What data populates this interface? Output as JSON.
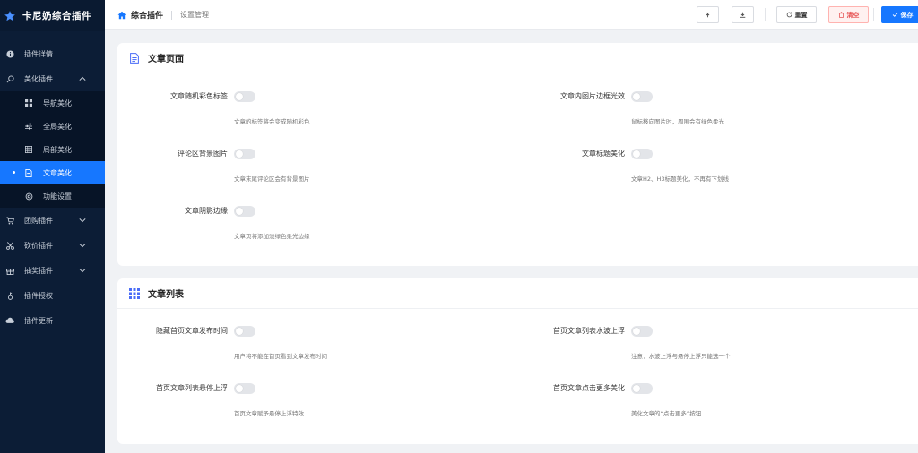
{
  "app": {
    "title": "卡尼奶综合插件"
  },
  "sidebar": {
    "items": [
      {
        "label": "插件详情",
        "icon": "info-icon"
      },
      {
        "label": "美化插件",
        "icon": "search-icon",
        "expanded": true
      },
      {
        "label": "导航美化",
        "icon": "grid-icon"
      },
      {
        "label": "全局美化",
        "icon": "sliders-icon"
      },
      {
        "label": "局部美化",
        "icon": "table-icon"
      },
      {
        "label": "文章美化",
        "icon": "document-icon",
        "active": true
      },
      {
        "label": "功能设置",
        "icon": "settings-icon"
      },
      {
        "label": "团购插件",
        "icon": "cart-icon"
      },
      {
        "label": "砍价插件",
        "icon": "scissors-icon"
      },
      {
        "label": "抽奖插件",
        "icon": "gift-icon"
      },
      {
        "label": "插件授权",
        "icon": "key-icon"
      },
      {
        "label": "插件更新",
        "icon": "cloud-icon"
      }
    ]
  },
  "header": {
    "breadcrumb_home": "综合插件",
    "breadcrumb_current": "设置管理",
    "reset_label": "重置",
    "clear_label": "清空",
    "save_label": "保存"
  },
  "sections": [
    {
      "title": "文章页面",
      "settings": [
        {
          "label": "文章随机彩色标签",
          "hint": "文章的标签将会变成随机彩色",
          "enabled": false
        },
        {
          "label": "文章内图片边框光效",
          "hint": "鼠标移向图片时，周围会有绿色柔光",
          "enabled": false
        },
        {
          "label": "评论区背景图片",
          "hint": "文章末尾评论区会有背景图片",
          "enabled": false
        },
        {
          "label": "文章标题美化",
          "hint": "文章H2、H3标题美化，不再有下划线",
          "enabled": false
        },
        {
          "label": "文章阴影边缘",
          "hint": "文章页将添加淡绿色柔光边缘",
          "enabled": false
        }
      ]
    },
    {
      "title": "文章列表",
      "settings": [
        {
          "label": "隐藏首页文章发布时间",
          "hint": "用户将不能在首页看到文章发布时间",
          "enabled": false
        },
        {
          "label": "首页文章列表水波上浮",
          "hint": "注意：水波上浮与悬停上浮只能选一个",
          "enabled": false
        },
        {
          "label": "首页文章列表悬停上浮",
          "hint": "首页文章赋予悬停上浮特效",
          "enabled": false
        },
        {
          "label": "首页文章点击更多美化",
          "hint": "美化文章的“点击更多”按钮",
          "enabled": false
        }
      ]
    }
  ],
  "colors": {
    "sidebar": "#0c1d36",
    "accent": "#1677ff",
    "danger": "#e54848"
  }
}
